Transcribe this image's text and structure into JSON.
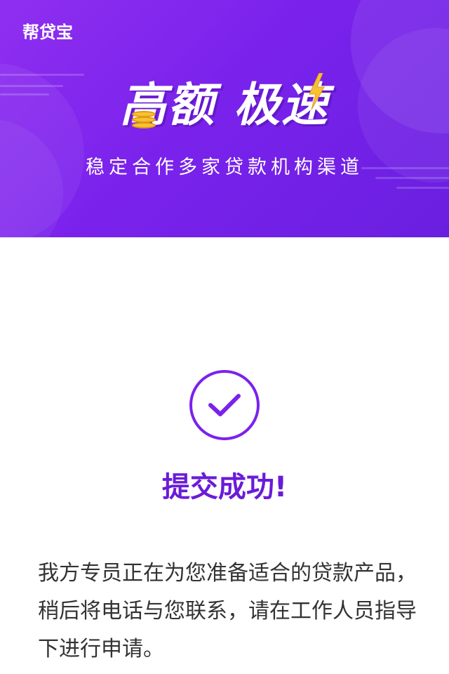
{
  "banner": {
    "logo_text": "帮贷宝",
    "headline_part1": "高额",
    "headline_part2": "极速",
    "subtitle": "稳定合作多家贷款机构渠道",
    "gradient_start": "#8f2ff0",
    "gradient_end": "#6a1fe0"
  },
  "result": {
    "icon": "checkmark-circle-icon",
    "title": "提交成功!",
    "description": "我方专员正在为您准备适合的贷款产品，稍后将电话与您联系，请在工作人员指导下进行申请。",
    "accent_color": "#7a22ec"
  }
}
